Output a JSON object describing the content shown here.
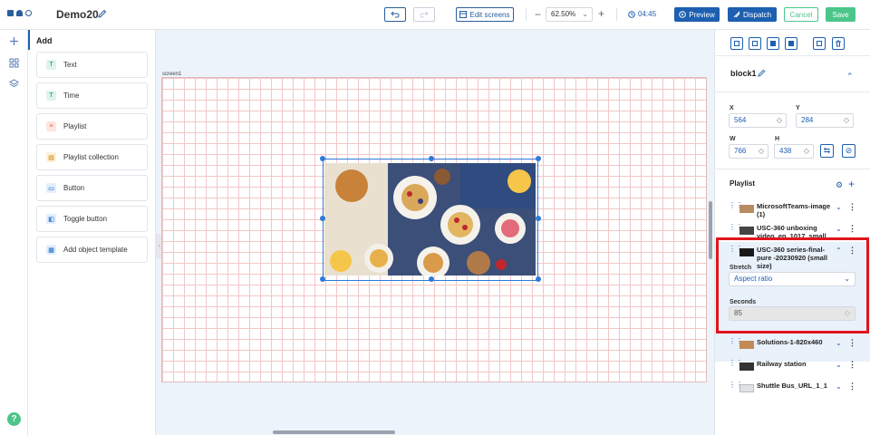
{
  "app": {
    "title": "Demo20"
  },
  "toolbar": {
    "edit_screens": "Edit screens",
    "zoom": "62.50%",
    "time": "04:45",
    "preview": "Preview",
    "dispatch": "Dispatch",
    "cancel": "Cancel",
    "save": "Save"
  },
  "add_panel": {
    "title": "Add",
    "items": [
      {
        "label": "Text",
        "icon": "text-icon"
      },
      {
        "label": "Time",
        "icon": "time-icon"
      },
      {
        "label": "Playlist",
        "icon": "playlist-icon"
      },
      {
        "label": "Playlist collection",
        "icon": "playlist-collection-icon"
      },
      {
        "label": "Button",
        "icon": "button-icon"
      },
      {
        "label": "Toggle button",
        "icon": "toggle-button-icon"
      },
      {
        "label": "Add object template",
        "icon": "template-icon"
      }
    ]
  },
  "canvas": {
    "screen_label": "screen1"
  },
  "properties": {
    "block_name": "block1",
    "x_label": "X",
    "x_value": "564",
    "y_label": "Y",
    "y_value": "284",
    "w_label": "W",
    "w_value": "766",
    "h_label": "H",
    "h_value": "438"
  },
  "playlist": {
    "title": "Playlist",
    "items": [
      {
        "name": "MicrosoftTeams-image (1)"
      },
      {
        "name": "USC-360 unboxing video_ep_1017_small"
      },
      {
        "name": "USC-360 series-final-pure -20230920 (small size)"
      },
      {
        "name": "Solutions-1-820x460"
      },
      {
        "name": "Railway station"
      },
      {
        "name": "Shuttle Bus_URL_1_1"
      }
    ],
    "stretch_label": "Stretch",
    "stretch_value": "Aspect ratio",
    "seconds_label": "Seconds",
    "seconds_value": "85"
  },
  "colors": {
    "accent": "#1d5fb0",
    "success": "#4cc58a",
    "highlight": "#e0141e"
  }
}
